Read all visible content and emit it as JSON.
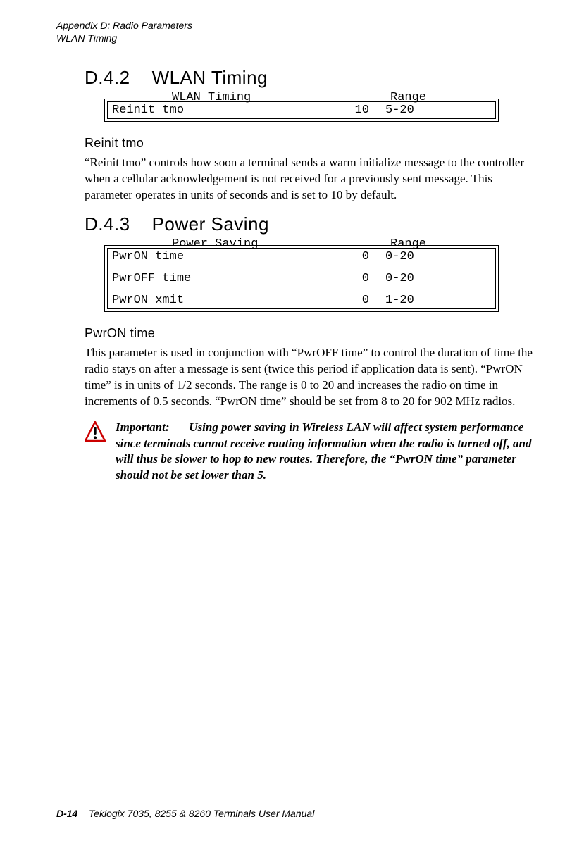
{
  "running_head": {
    "line1": "Appendix D: Radio Parameters",
    "line2": "WLAN Timing"
  },
  "sec_wlan": {
    "number": "D.4.2",
    "title": "WLAN Timing",
    "box": {
      "legend_main": "WLAN Timing",
      "legend_range": "Range",
      "rows": [
        {
          "name": "Reinit tmo",
          "value": "10",
          "range": "5-20"
        }
      ]
    },
    "sub": {
      "title": "Reinit tmo",
      "body": "“Reinit tmo” controls how soon a terminal sends a warm initialize message to the controller when a cellular acknowledgement is not received for a previously sent message. This parameter operates in units of seconds and is set to 10 by default."
    }
  },
  "sec_power": {
    "number": "D.4.3",
    "title": "Power Saving",
    "box": {
      "legend_main": "Power Saving",
      "legend_range": "Range",
      "rows": [
        {
          "name": "PwrON time",
          "value": "0",
          "range": "0-20"
        },
        {
          "name": "PwrOFF time",
          "value": "0",
          "range": "0-20"
        },
        {
          "name": "PwrON xmit",
          "value": "0",
          "range": "1-20"
        }
      ]
    },
    "sub": {
      "title": "PwrON time",
      "body": "This parameter is used in conjunction with “PwrOFF time” to control the duration of time the radio stays on after a message is sent (twice this period if application data is sent). “PwrON time” is in units of 1/2 seconds. The range is 0 to 20 and increases the radio on time in increments of 0.5 seconds. “PwrON time” should be set from 8 to 20 for 902 MHz radios."
    },
    "important": {
      "label": "Important:",
      "msg": "Using power saving in Wireless LAN will affect system performance since terminals cannot receive routing information when the radio is turned off, and will thus be slower to hop to new routes. Therefore, the “PwrON time” parameter should not be set lower than 5."
    }
  },
  "footer": {
    "page": "D-14",
    "title": "Teklogix 7035, 8255 & 8260 Terminals User Manual"
  }
}
